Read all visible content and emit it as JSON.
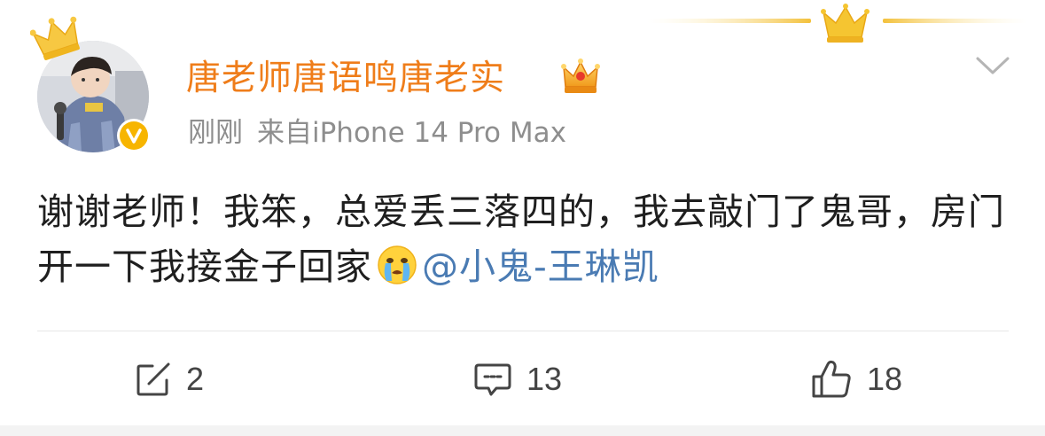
{
  "post": {
    "author": {
      "name": "唐老师唐语鸣唐老实",
      "avatar_icon": "user-avatar",
      "verified_icon": "verified-badge-icon",
      "vip_icon": "vip-crown-icon",
      "name_color": "#ef7d1a"
    },
    "meta": {
      "time": "刚刚",
      "source": "来自iPhone 14 Pro Max"
    },
    "content": {
      "text_line": "谢谢老师！我笨，总爱丢三落四的，我去敲门了鬼哥，房门开一下我接金子回家",
      "emoji_icon": "crying-face-emoji",
      "mention": "@小鬼-王琳凯",
      "mention_color": "#4a7bb3"
    },
    "actions": {
      "repost_count": "2",
      "comment_count": "13",
      "like_count": "18",
      "repost_icon": "share-icon",
      "comment_icon": "comment-icon",
      "like_icon": "thumbs-up-icon"
    },
    "menu_icon": "chevron-down-icon"
  }
}
